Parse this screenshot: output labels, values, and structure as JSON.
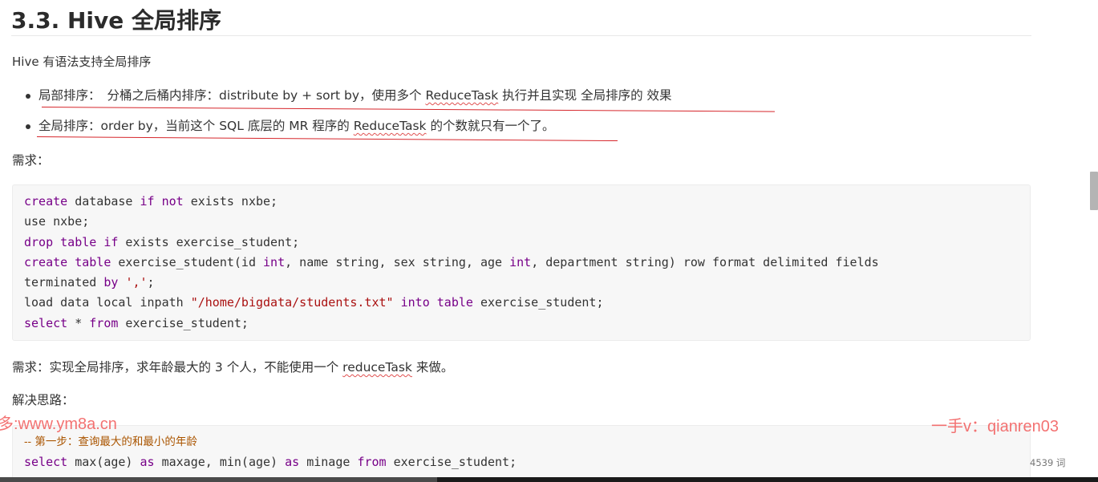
{
  "heading": "3.3. Hive 全局排序",
  "intro": "Hive 有语法支持全局排序",
  "bullets": [
    {
      "term": "局部排序：",
      "before": "分桶之后桶内排序：distribute by + sort by，使用多个 ",
      "reduce": "ReduceTask",
      "after": " 执行并且实现 全局排序的 效果"
    },
    {
      "term": "全局排序：",
      "before": "order by，当前这个 SQL 底层的 MR 程序的 ",
      "reduce": "ReduceTask",
      "after": " 的个数就只有一个了。"
    }
  ],
  "requirement_label": "需求：",
  "code_lines": [
    "create database if not exists nxbe;",
    "use nxbe;",
    "drop table if exists exercise_student;",
    "create table exercise_student(id int, name string, sex string, age int, department string) row format delimited fields",
    "terminated by ',';",
    "load data local inpath \"/home/bigdata/students.txt\" into table exercise_student;",
    "select * from exercise_student;"
  ],
  "requirement2": {
    "before": "需求：实现全局排序，求年龄最大的 3 个人，不能使用一个 ",
    "word": "reduceTask",
    "after": " 来做。"
  },
  "solution_label": "解决思路：",
  "code2_lines": [
    "-- 第一步：查询最大的和最小的年龄",
    "select max(age) as maxage, min(age) as minage from exercise_student;"
  ],
  "watermark_left": "多:www.ym8a.cn",
  "watermark_right": "一手v：qianren03",
  "word_count": "4539 词",
  "colors": {
    "annotation_red": "#d6262b",
    "keyword": "#770088",
    "string": "#aa1111",
    "comment": "#aa5500",
    "watermark": "#f25a5a"
  }
}
